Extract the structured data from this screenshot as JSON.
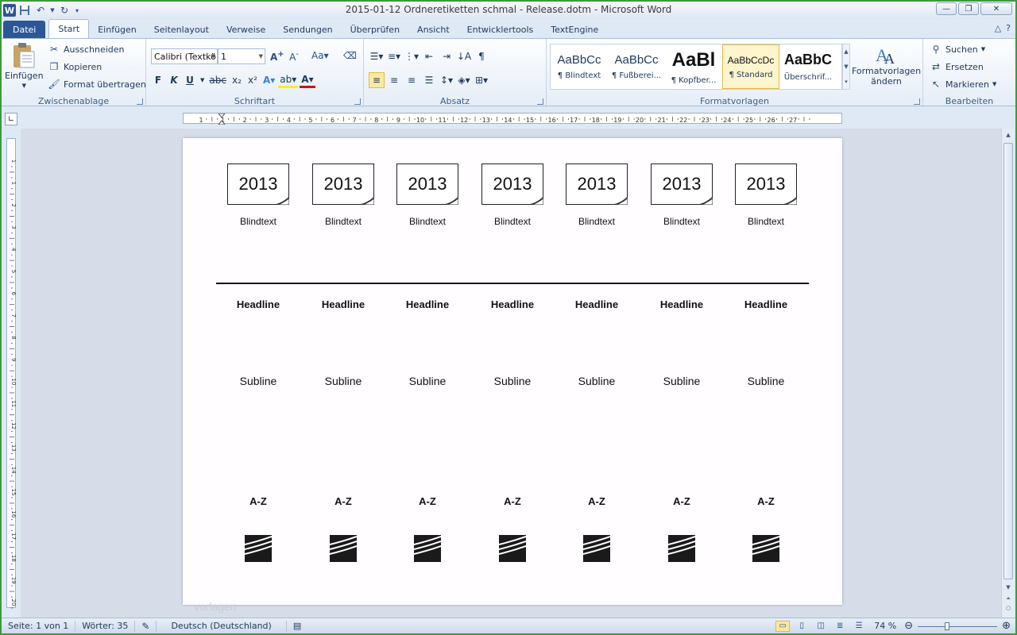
{
  "window": {
    "title": "2015-01-12 Ordneretiketten schmal - Release.dotm - Microsoft Word",
    "app_icon": "W",
    "colors": {
      "accent": "#2b5797",
      "frame": "#3c9a3c"
    }
  },
  "tabs": {
    "file": "Datei",
    "items": [
      "Start",
      "Einfügen",
      "Seitenlayout",
      "Verweise",
      "Sendungen",
      "Überprüfen",
      "Ansicht",
      "Entwicklertools",
      "TextEngine"
    ],
    "active": "Start"
  },
  "ribbon": {
    "clipboard": {
      "label": "Zwischenablage",
      "paste": "Einfügen",
      "cut": "Ausschneiden",
      "copy": "Kopieren",
      "format_painter": "Format übertragen"
    },
    "font": {
      "label": "Schriftart",
      "font_name": "Calibri (Textkö",
      "font_size": "1"
    },
    "paragraph": {
      "label": "Absatz"
    },
    "styles": {
      "label": "Formatvorlagen",
      "items": [
        {
          "sample": "AaBbCc",
          "name": "¶ Blindtext"
        },
        {
          "sample": "AaBbCc",
          "name": "¶ Fußberei..."
        },
        {
          "sample": "AaBl",
          "name": "¶ Kopfber..."
        },
        {
          "sample": "AaBbCcDc",
          "name": "¶ Standard"
        },
        {
          "sample": "AaBbC",
          "name": "Überschrif..."
        }
      ],
      "active_index": 3,
      "change_styles": "Formatvorlagen",
      "change_styles_2": "ändern"
    },
    "editing": {
      "label": "Bearbeiten",
      "find": "Suchen",
      "replace": "Ersetzen",
      "select": "Markieren"
    }
  },
  "document": {
    "years": [
      "2013",
      "2013",
      "2013",
      "2013",
      "2013",
      "2013",
      "2013"
    ],
    "labels": [
      "Blindtext",
      "Blindtext",
      "Blindtext",
      "Blindtext",
      "Blindtext",
      "Blindtext",
      "Blindtext"
    ],
    "headlines": [
      "Headline",
      "Headline",
      "Headline",
      "Headline",
      "Headline",
      "Headline",
      "Headline"
    ],
    "sublines": [
      "Subline",
      "Subline",
      "Subline",
      "Subline",
      "Subline",
      "Subline",
      "Subline"
    ],
    "az": [
      "A-Z",
      "A-Z",
      "A-Z",
      "A-Z",
      "A-Z",
      "A-Z",
      "A-Z"
    ],
    "watermark": "vorlagen"
  },
  "ruler": {
    "labels": [
      "1",
      "1",
      "2",
      "3",
      "4",
      "5",
      "6",
      "7",
      "8",
      "9",
      "10",
      "11",
      "12",
      "13",
      "14",
      "15",
      "16",
      "17",
      "18",
      "19",
      "20",
      "21",
      "22",
      "23",
      "24",
      "25",
      "26",
      "27"
    ],
    "vlabels": [
      "1",
      "1",
      "2",
      "3",
      "4",
      "5",
      "6",
      "7",
      "8",
      "9",
      "10",
      "11",
      "12",
      "13",
      "14",
      "15",
      "16",
      "17",
      "18",
      "19",
      "20"
    ]
  },
  "status": {
    "page": "Seite: 1 von 1",
    "words": "Wörter: 35",
    "language": "Deutsch (Deutschland)",
    "zoom": "74 %",
    "zoom_level": 74
  }
}
